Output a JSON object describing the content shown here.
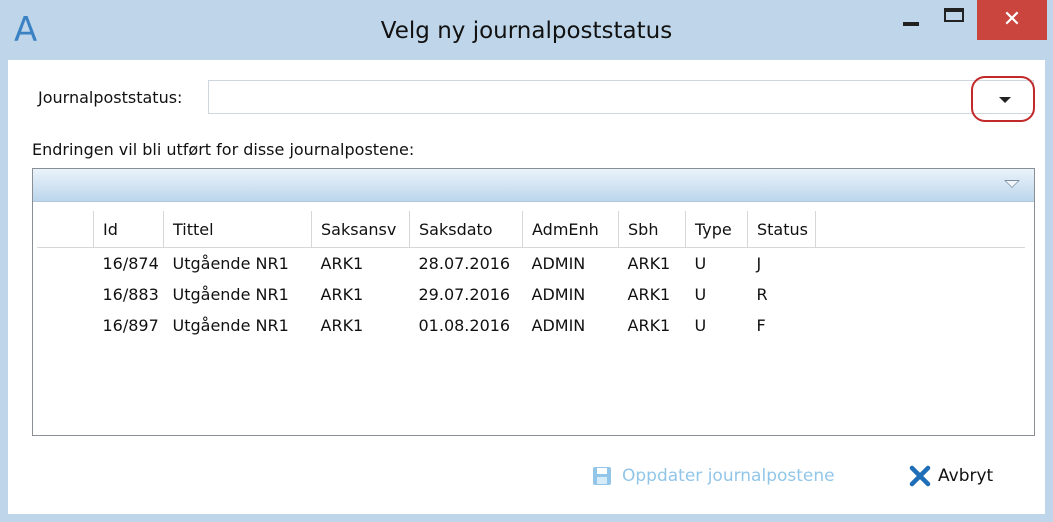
{
  "window": {
    "title": "Velg ny journalpoststatus",
    "close_glyph": "✕"
  },
  "form": {
    "status_label": "Journalpoststatus:",
    "status_value": "",
    "changes_label": "Endringen vil bli utført for disse journalpostene:"
  },
  "grid": {
    "columns": [
      "Id",
      "Tittel",
      "Saksansv",
      "Saksdato",
      "AdmEnh",
      "Sbh",
      "Type",
      "Status"
    ],
    "rows": [
      [
        "16/874",
        "Utgående NR1",
        "ARK1",
        "28.07.2016",
        "ADMIN",
        "ARK1",
        "U",
        "J"
      ],
      [
        "16/883",
        "Utgående NR1",
        "ARK1",
        "29.07.2016",
        "ADMIN",
        "ARK1",
        "U",
        "R"
      ],
      [
        "16/897",
        "Utgående NR1",
        "ARK1",
        "01.08.2016",
        "ADMIN",
        "ARK1",
        "U",
        "F"
      ]
    ]
  },
  "footer": {
    "update_label": "Oppdater journalpostene",
    "cancel_label": "Avbryt"
  },
  "icons": {
    "app": "A",
    "save": "save-icon",
    "cancel": "x-icon"
  },
  "colors": {
    "accent": "#3b82c4",
    "close_button": "#c9453e",
    "highlight_ring": "#c22a2a",
    "disabled_text": "#92c6e8"
  }
}
